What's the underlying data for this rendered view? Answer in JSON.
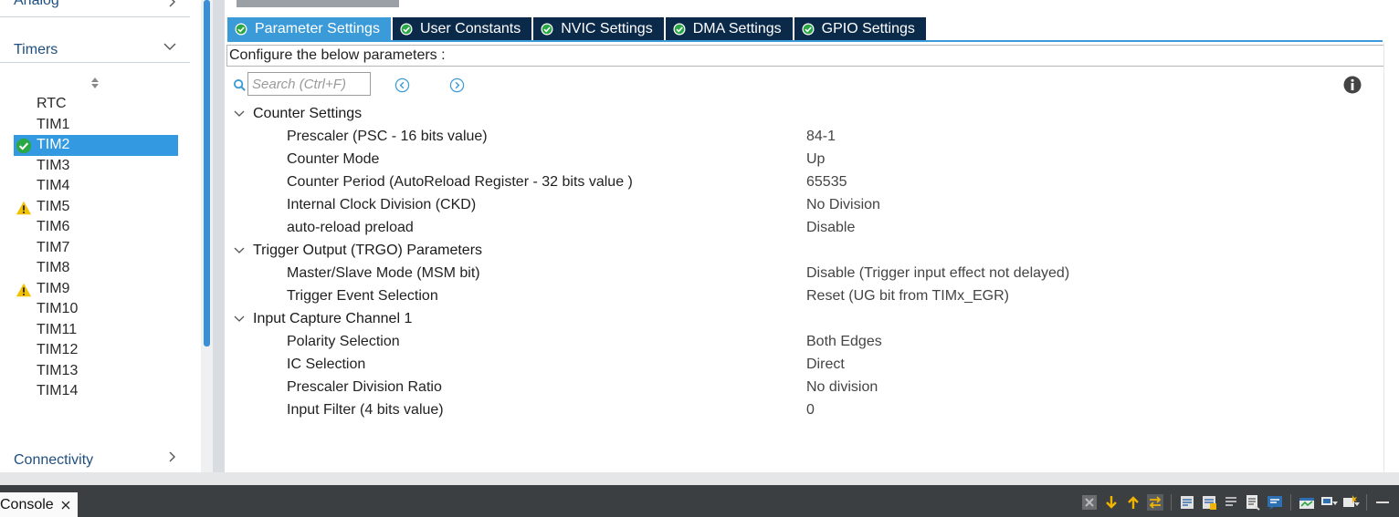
{
  "sidebar": {
    "categories": {
      "analog": "Analog",
      "timers": "Timers",
      "connectivity": "Connectivity"
    },
    "timers": [
      {
        "label": "RTC",
        "status": "none",
        "selected": false
      },
      {
        "label": "TIM1",
        "status": "none",
        "selected": false
      },
      {
        "label": "TIM2",
        "status": "ok",
        "selected": true
      },
      {
        "label": "TIM3",
        "status": "none",
        "selected": false
      },
      {
        "label": "TIM4",
        "status": "none",
        "selected": false
      },
      {
        "label": "TIM5",
        "status": "warning",
        "selected": false
      },
      {
        "label": "TIM6",
        "status": "none",
        "selected": false
      },
      {
        "label": "TIM7",
        "status": "none",
        "selected": false
      },
      {
        "label": "TIM8",
        "status": "none",
        "selected": false
      },
      {
        "label": "TIM9",
        "status": "warning",
        "selected": false
      },
      {
        "label": "TIM10",
        "status": "none",
        "selected": false
      },
      {
        "label": "TIM11",
        "status": "none",
        "selected": false
      },
      {
        "label": "TIM12",
        "status": "none",
        "selected": false
      },
      {
        "label": "TIM13",
        "status": "none",
        "selected": false
      },
      {
        "label": "TIM14",
        "status": "none",
        "selected": false
      }
    ]
  },
  "tabs": [
    {
      "label": "Parameter Settings",
      "active": true
    },
    {
      "label": "User Constants",
      "active": false
    },
    {
      "label": "NVIC Settings",
      "active": false
    },
    {
      "label": "DMA Settings",
      "active": false
    },
    {
      "label": "GPIO Settings",
      "active": false
    }
  ],
  "configure_label": "Configure the below parameters :",
  "search": {
    "placeholder": "Search (Ctrl+F)",
    "value": ""
  },
  "groups": [
    {
      "label": "Counter Settings",
      "params": [
        {
          "name": "Prescaler (PSC - 16 bits value)",
          "value": "84-1"
        },
        {
          "name": "Counter Mode",
          "value": "Up"
        },
        {
          "name": "Counter Period (AutoReload Register - 32 bits value )",
          "value": "65535"
        },
        {
          "name": "Internal Clock Division (CKD)",
          "value": "No Division"
        },
        {
          "name": "auto-reload preload",
          "value": "Disable"
        }
      ]
    },
    {
      "label": "Trigger Output (TRGO) Parameters",
      "params": [
        {
          "name": "Master/Slave Mode (MSM bit)",
          "value": "Disable (Trigger input effect not delayed)"
        },
        {
          "name": "Trigger Event Selection",
          "value": "Reset (UG bit from TIMx_EGR)"
        }
      ]
    },
    {
      "label": "Input Capture Channel 1",
      "params": [
        {
          "name": "Polarity Selection",
          "value": "Both Edges"
        },
        {
          "name": "IC Selection",
          "value": "Direct"
        },
        {
          "name": "Prescaler Division Ratio",
          "value": "No division"
        },
        {
          "name": "Input Filter (4 bits value)",
          "value": "0"
        }
      ]
    }
  ],
  "console": {
    "tab_label": "Console"
  },
  "colors": {
    "accent": "#3b9bd9",
    "tab_dark": "#0b2a4a",
    "selected_row": "#3399e0",
    "ok_green": "#2aa845",
    "warning_yellow": "#f2c200"
  },
  "icons": {
    "ok": "check-circle-icon",
    "warning": "warning-triangle-icon",
    "toolbar": [
      "terminate-icon",
      "scroll-down-icon",
      "scroll-up-icon",
      "pin-icon",
      "word-wrap-icon",
      "clear-console-icon",
      "show-on-output-icon",
      "show-on-error-icon",
      "open-console-icon",
      "display-console-icon",
      "new-console-icon"
    ]
  }
}
